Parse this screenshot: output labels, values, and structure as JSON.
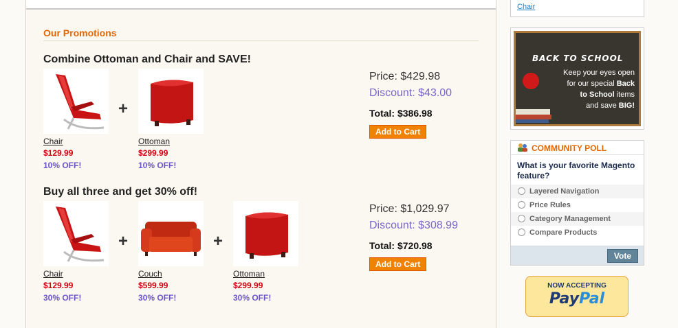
{
  "promotions": {
    "title": "Our Promotions",
    "bundles": [
      {
        "heading": "Combine Ottoman and Chair and SAVE!",
        "items": [
          {
            "name": "Chair",
            "price": "$129.99",
            "discount": "10% OFF!",
            "icon": "red-chair-image"
          },
          {
            "name": "Ottoman",
            "price": "$299.99",
            "discount": "10% OFF!",
            "icon": "red-ottoman-image"
          }
        ],
        "price": "Price: $429.98",
        "discount": "Discount: $43.00",
        "total": "Total: $386.98",
        "cart_label": "Add to Cart"
      },
      {
        "heading": "Buy all three and get 30% off!",
        "items": [
          {
            "name": "Chair",
            "price": "$129.99",
            "discount": "30% OFF!",
            "icon": "red-chair-image"
          },
          {
            "name": "Couch",
            "price": "$599.99",
            "discount": "30% OFF!",
            "icon": "red-couch-image"
          },
          {
            "name": "Ottoman",
            "price": "$299.99",
            "discount": "30% OFF!",
            "icon": "red-ottoman-image"
          }
        ],
        "price": "Price: $1,029.97",
        "discount": "Discount: $308.99",
        "total": "Total: $720.98",
        "cart_label": "Add to Cart"
      }
    ],
    "plus_sign": "+"
  },
  "sidebar": {
    "top_link": "Chair",
    "banner": {
      "title": "BACK TO SCHOOL",
      "line1": "Keep your eyes open",
      "line2a": "for our special ",
      "line2b": "Back",
      "line3b": "to School",
      "line3a": " items",
      "line4a": "and save ",
      "line4b": "BIG!"
    },
    "poll": {
      "title": "COMMUNITY POLL",
      "question": "What is your favorite Magento feature?",
      "options": [
        "Layered Navigation",
        "Price Rules",
        "Category Management",
        "Compare Products"
      ],
      "vote_label": "Vote"
    },
    "paypal": {
      "top": "NOW ACCEPTING",
      "logo_a": "Pay",
      "logo_b": "Pal"
    }
  },
  "colors": {
    "accent_orange": "#e26703",
    "price_red": "#d3000f",
    "discount_purple": "#6b56c9",
    "button_orange": "#f18200"
  }
}
